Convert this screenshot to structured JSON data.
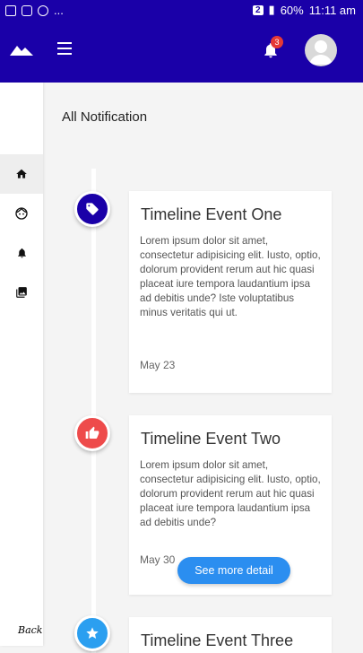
{
  "status_bar": {
    "sim_badge": "2",
    "battery": "60%",
    "time": "11:11 am",
    "dots": "..."
  },
  "header": {
    "notification_count": "3",
    "colors": {
      "primary": "#1a00a8",
      "badge": "#e53935"
    }
  },
  "sidebar": {
    "items": [
      {
        "icon": "home-icon",
        "active": true
      },
      {
        "icon": "face-icon",
        "active": false
      },
      {
        "icon": "bell-icon",
        "active": false
      },
      {
        "icon": "photo-library-icon",
        "active": false
      }
    ],
    "back_label": "Back"
  },
  "main": {
    "title": "All Notification",
    "events": [
      {
        "title": "Timeline Event One",
        "body": "Lorem ipsum dolor sit amet, consectetur adipisicing elit. Iusto, optio, dolorum provident rerum aut hic quasi placeat iure tempora laudantium ipsa ad debitis unde? Iste voluptatibus minus veritatis qui ut.",
        "date": "May 23",
        "icon": "tag-icon",
        "color": "#1a00a8"
      },
      {
        "title": "Timeline Event Two",
        "body": "Lorem ipsum dolor sit amet, consectetur adipisicing elit. Iusto, optio, dolorum provident rerum aut hic quasi placeat iure tempora laudantium ipsa ad debitis unde?",
        "date": "May 30",
        "icon": "thumbs-up-icon",
        "color": "#ee4b4b",
        "button": "See more detail"
      },
      {
        "title": "Timeline Event Three",
        "icon": "star-icon",
        "color": "#2b9ff0"
      }
    ]
  }
}
